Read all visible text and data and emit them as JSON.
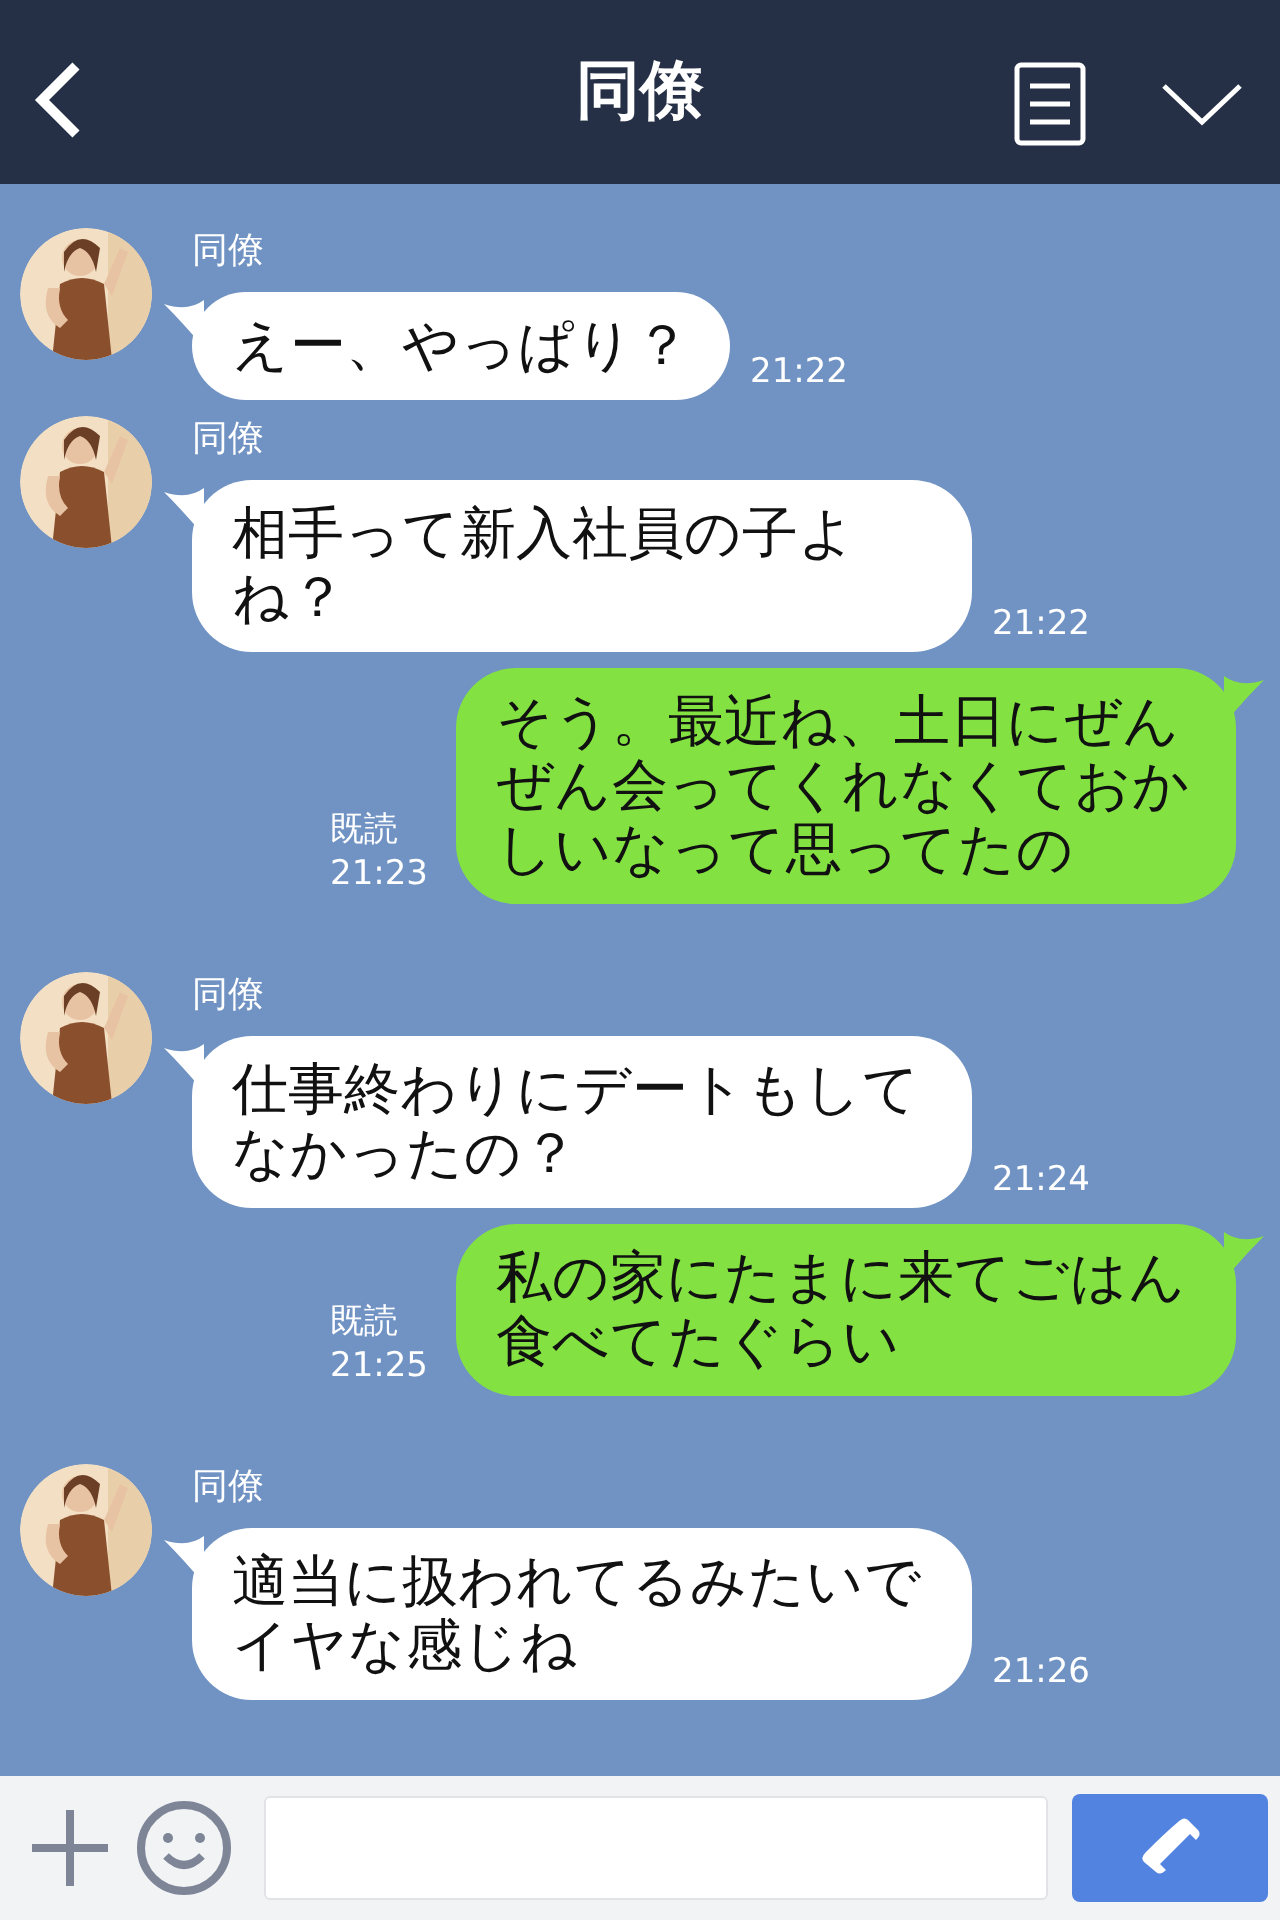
{
  "header": {
    "title": "同僚"
  },
  "messages": [
    {
      "kind": "received",
      "name": "同僚",
      "text": "えー、やっぱり？",
      "time": "21:22"
    },
    {
      "kind": "received",
      "name": "同僚",
      "text": "相手って新入社員の子よね？",
      "time": "21:22"
    },
    {
      "kind": "sent",
      "read": "既読",
      "text": "そう。最近ね、土日にぜんぜん会ってくれなくておかしいなって思ってたの",
      "time": "21:23"
    },
    {
      "kind": "received",
      "name": "同僚",
      "text": "仕事終わりにデートもしてなかったの？",
      "time": "21:24"
    },
    {
      "kind": "sent",
      "read": "既読",
      "text": "私の家にたまに来てごはん食べてたぐらい",
      "time": "21:25"
    },
    {
      "kind": "received",
      "name": "同僚",
      "text": "適当に扱われてるみたいでイヤな感じね",
      "time": "21:26"
    }
  ]
}
